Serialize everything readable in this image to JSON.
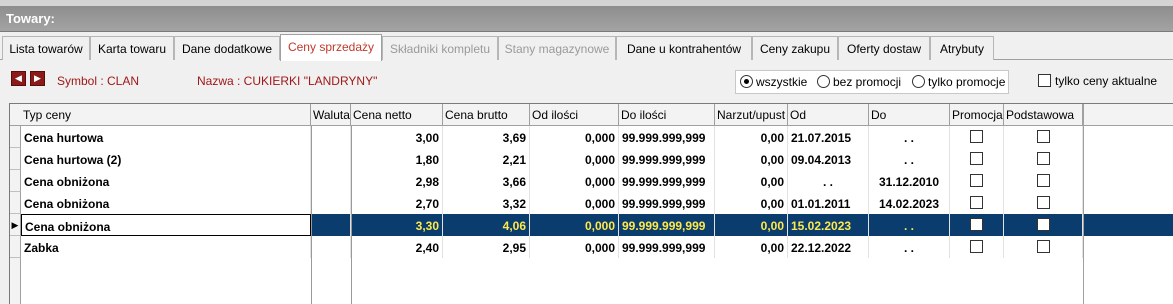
{
  "window": {
    "title": "Towary:"
  },
  "tabs": [
    {
      "label": "Lista towarów",
      "state": "normal"
    },
    {
      "label": "Karta towaru",
      "state": "normal"
    },
    {
      "label": "Dane dodatkowe",
      "state": "normal"
    },
    {
      "label": "Ceny sprzedaży",
      "state": "active"
    },
    {
      "label": "Składniki kompletu",
      "state": "disabled"
    },
    {
      "label": "Stany magazynowe",
      "state": "disabled"
    },
    {
      "label": "Dane u kontrahentów",
      "state": "normal"
    },
    {
      "label": "Ceny zakupu",
      "state": "normal"
    },
    {
      "label": "Oferty dostaw",
      "state": "normal"
    },
    {
      "label": "Atrybuty",
      "state": "normal"
    }
  ],
  "toolbar": {
    "prev_icon": "◀",
    "next_icon": "▶",
    "symbol_label": "Symbol : CLAN",
    "nazwa_label": "Nazwa : CUKIERKI \"LANDRYNY\"",
    "filter_options": [
      {
        "label": "wszystkie",
        "selected": true
      },
      {
        "label": "bez promocji",
        "selected": false
      },
      {
        "label": "tylko promocje",
        "selected": false
      }
    ],
    "aktualne_label": "tylko ceny aktualne",
    "aktualne_checked": false
  },
  "grid": {
    "columns": [
      "Typ ceny",
      "Waluta",
      "Cena netto",
      "Cena brutto",
      "Od ilości",
      "Do ilości",
      "Narzut/upust",
      "Od",
      "Do",
      "Promocja",
      "Podstawowa"
    ],
    "rows": [
      {
        "typ": "Cena hurtowa",
        "waluta": "",
        "netto": "3,00",
        "brutto": "3,69",
        "od_ilosci": "0,000",
        "do_ilosci": "99.999.999,999",
        "narzut": "0,00",
        "od": "21.07.2015",
        "do": ". .",
        "promocja": false,
        "podstawowa": false,
        "selected": false
      },
      {
        "typ": "Cena hurtowa (2)",
        "waluta": "",
        "netto": "1,80",
        "brutto": "2,21",
        "od_ilosci": "0,000",
        "do_ilosci": "99.999.999,999",
        "narzut": "0,00",
        "od": "09.04.2013",
        "do": ". .",
        "promocja": false,
        "podstawowa": false,
        "selected": false
      },
      {
        "typ": "Cena obniżona",
        "waluta": "",
        "netto": "2,98",
        "brutto": "3,66",
        "od_ilosci": "0,000",
        "do_ilosci": "99.999.999,999",
        "narzut": "0,00",
        "od": ". .",
        "do": "31.12.2010",
        "promocja": false,
        "podstawowa": false,
        "selected": false
      },
      {
        "typ": "Cena obniżona",
        "waluta": "",
        "netto": "2,70",
        "brutto": "3,32",
        "od_ilosci": "0,000",
        "do_ilosci": "99.999.999,999",
        "narzut": "0,00",
        "od": "01.01.2011",
        "do": "14.02.2023",
        "promocja": false,
        "podstawowa": false,
        "selected": false
      },
      {
        "typ": "Cena obniżona",
        "waluta": "",
        "netto": "3,30",
        "brutto": "4,06",
        "od_ilosci": "0,000",
        "do_ilosci": "99.999.999,999",
        "narzut": "0,00",
        "od": "15.02.2023",
        "do": ". .",
        "promocja": false,
        "podstawowa": false,
        "selected": true
      },
      {
        "typ": "Zabka",
        "waluta": "",
        "netto": "2,40",
        "brutto": "2,95",
        "od_ilosci": "0,000",
        "do_ilosci": "99.999.999,999",
        "narzut": "0,00",
        "od": "22.12.2022",
        "do": ". .",
        "promocja": false,
        "podstawowa": false,
        "selected": false
      }
    ],
    "row_indicator_icon": "▶"
  },
  "colors": {
    "selection": "#0a3c6e",
    "highlight_text": "#ffe94a",
    "accent_red": "#a01818"
  }
}
